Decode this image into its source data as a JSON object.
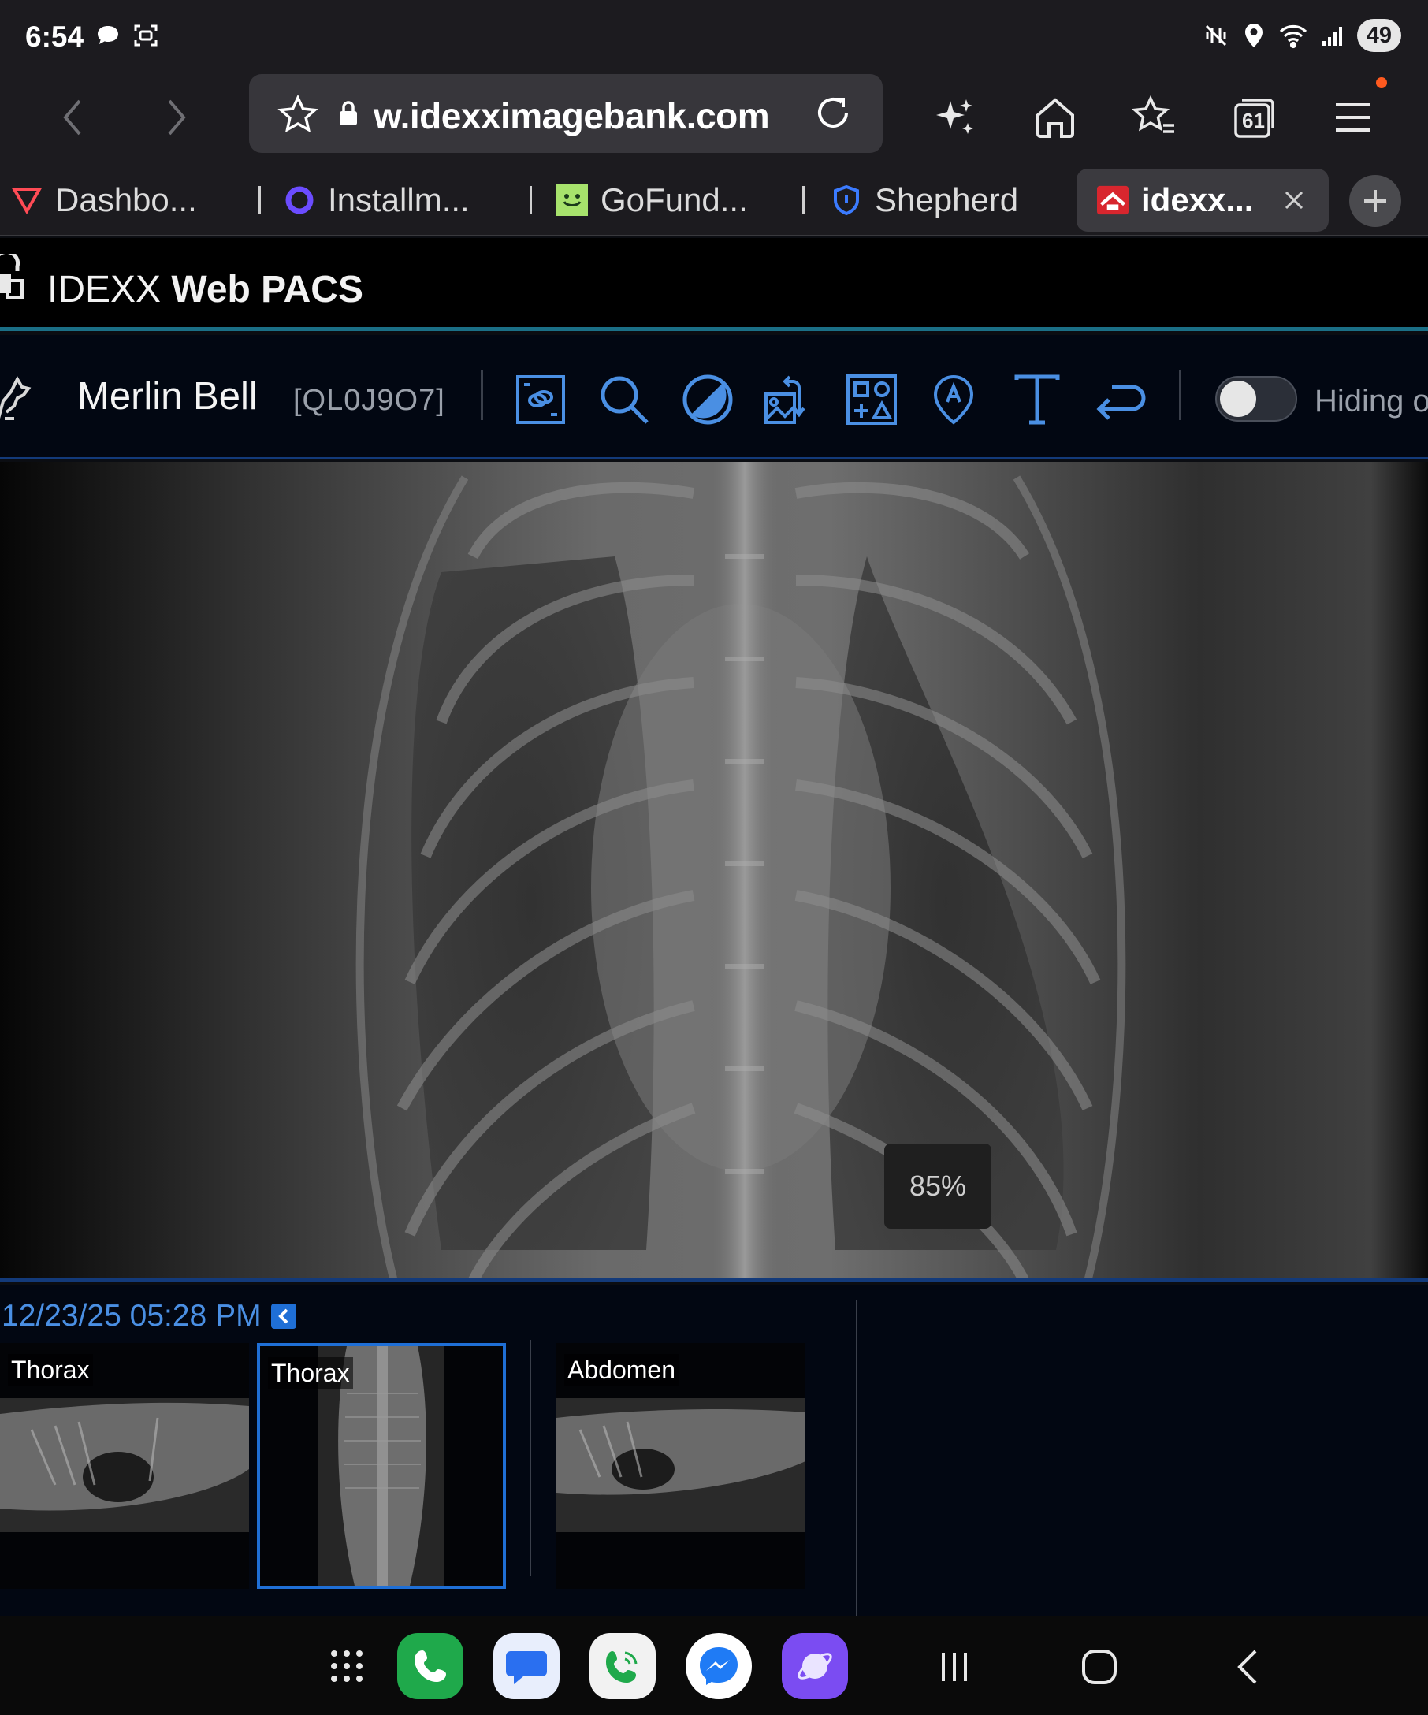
{
  "status_bar": {
    "time": "6:54",
    "battery": "49"
  },
  "browser": {
    "url": "w.idexximagebank.com",
    "tab_count": "61",
    "tabs": [
      {
        "label": "Dashbo..."
      },
      {
        "label": "Installm..."
      },
      {
        "label": "GoFund..."
      },
      {
        "label": "Shepherd"
      },
      {
        "label": "idexx..."
      }
    ]
  },
  "app": {
    "title_prefix": "IDEXX",
    "title_main": "Web PACS"
  },
  "patient": {
    "name": "Merlin Bell",
    "id": "[QL0J9O7]"
  },
  "toolbar": {
    "toggle_label": "Hiding o"
  },
  "viewer": {
    "zoom": "85%"
  },
  "series": {
    "date": "12/23/25 05:28 PM",
    "thumbnails": [
      {
        "label": "Thorax"
      },
      {
        "label": "Thorax"
      },
      {
        "label": "Abdomen"
      }
    ]
  }
}
